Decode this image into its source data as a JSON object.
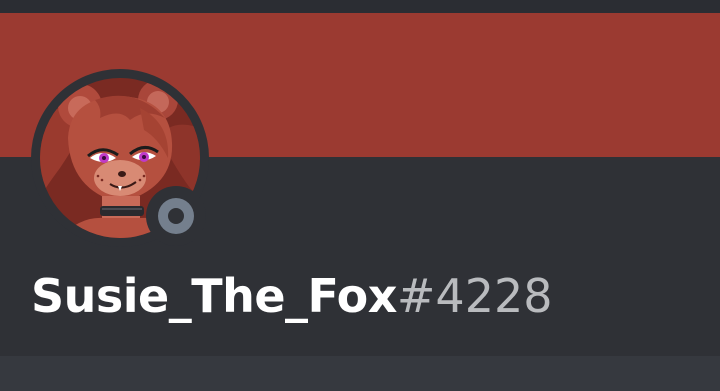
{
  "profile": {
    "username": "Susie_The_Fox",
    "discriminator": "#4228",
    "status": "offline",
    "banner_color": "#9b3a31",
    "status_color": "#747f8d"
  },
  "avatar": {
    "icon": "fox-character-avatar"
  }
}
